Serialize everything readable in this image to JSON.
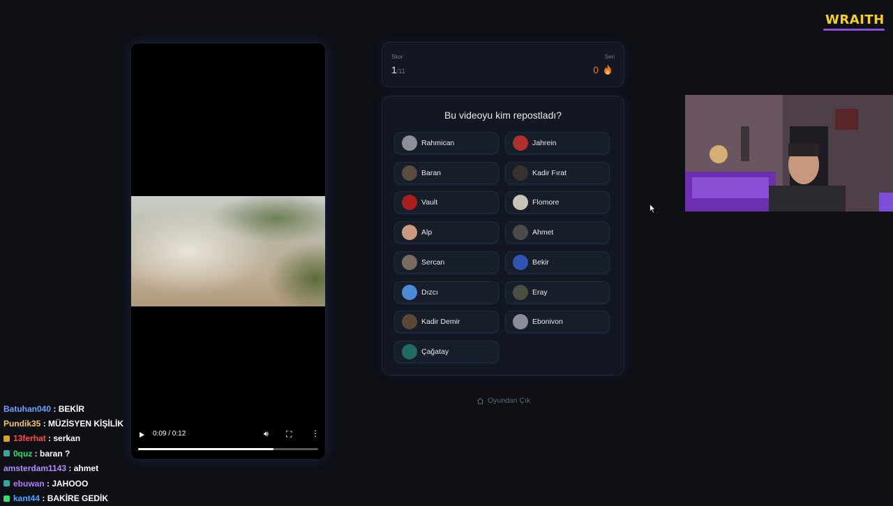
{
  "video": {
    "time": "0:09 / 0:12",
    "progress": 0.75
  },
  "score": {
    "label": "Skor",
    "value": "1",
    "total": "/11"
  },
  "streak": {
    "label": "Seri",
    "value": "0",
    "icon": "fire-icon"
  },
  "question": "Bu videoyu kim repostladı?",
  "options": [
    {
      "label": "Rahmican",
      "avatar": "#8c9098"
    },
    {
      "label": "Jahrein",
      "avatar": "#b0302c"
    },
    {
      "label": "Baran",
      "avatar": "#5b4a40"
    },
    {
      "label": "Kadir Fırat",
      "avatar": "#3a3030"
    },
    {
      "label": "Vault",
      "avatar": "#a5201c"
    },
    {
      "label": "Flomore",
      "avatar": "#c9c2b6"
    },
    {
      "label": "Alp",
      "avatar": "#c99a80"
    },
    {
      "label": "Ahmet",
      "avatar": "#4a4a4a"
    },
    {
      "label": "Sercan",
      "avatar": "#7a6a5e"
    },
    {
      "label": "Bekir",
      "avatar": "#2d56b4"
    },
    {
      "label": "Dızcı",
      "avatar": "#4a8ad6"
    },
    {
      "label": "Eray",
      "avatar": "#4e4d45"
    },
    {
      "label": "Kadir Demir",
      "avatar": "#5a4836"
    },
    {
      "label": "Ebonivon",
      "avatar": "#8a8e98"
    },
    {
      "label": "Çağatay",
      "avatar": "#1f6a62"
    }
  ],
  "exit_label": "Oyundan Çık",
  "logo": "WRAITH",
  "chat": [
    {
      "user": "Batuhan040",
      "color": "#6fa1ff",
      "badge": "",
      "msg": ": BEKİR"
    },
    {
      "user": "Pundik35",
      "color": "#f2c66b",
      "badge": "",
      "msg": ": MÜZİSYEN KİŞİLİK"
    },
    {
      "user": "13ferhat",
      "color": "#ff4d4d",
      "badge": "#d9a623",
      "msg": ": serkan"
    },
    {
      "user": "0quz",
      "color": "#2ee06e",
      "badge": "#2ea8a0",
      "msg": ": baran ?"
    },
    {
      "user": "amsterdam1143",
      "color": "#b58cff",
      "badge": "",
      "msg": ": ahmet"
    },
    {
      "user": "ebuwan",
      "color": "#b27bff",
      "badge": "#2ea8a0",
      "msg": ": JAHOOO"
    },
    {
      "user": "kant44",
      "color": "#4aa3ff",
      "badge": "#2ee06e",
      "msg": ": BAKİRE GEDİK"
    }
  ]
}
